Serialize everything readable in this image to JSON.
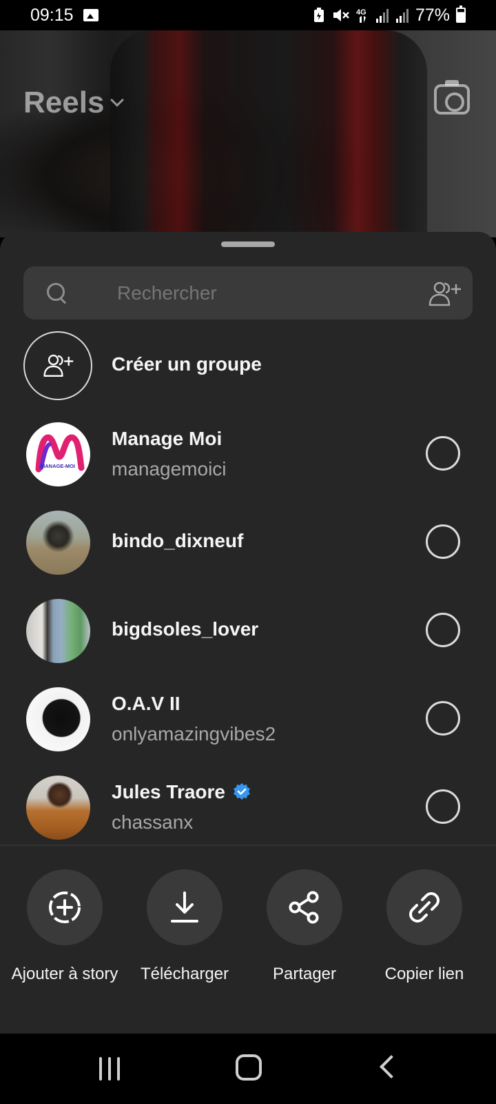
{
  "status_bar": {
    "time": "09:15",
    "battery": "77%",
    "network": "4G",
    "battery_level": 0.77
  },
  "background": {
    "title": "Reels"
  },
  "sheet": {
    "search": {
      "placeholder": "Rechercher"
    },
    "create_group": {
      "label": "Créer un groupe"
    },
    "contacts": [
      {
        "name": "Manage Moi",
        "username": "managemoici",
        "verified": false,
        "avatar_text": "MANAGE-MOI"
      },
      {
        "name": "bindo_dixneuf",
        "username": "",
        "verified": false
      },
      {
        "name": "bigdsoles_lover",
        "username": "",
        "verified": false
      },
      {
        "name": "O.A.V II",
        "username": "onlyamazingvibes2",
        "verified": false
      },
      {
        "name": "Jules Traore",
        "username": "chassanx",
        "verified": true
      }
    ],
    "actions": [
      {
        "label": "Ajouter à story",
        "icon": "add-circle-icon"
      },
      {
        "label": "Télécharger",
        "icon": "download-icon"
      },
      {
        "label": "Partager",
        "icon": "share-icon"
      },
      {
        "label": "Copier lien",
        "icon": "link-icon"
      }
    ]
  },
  "colors": {
    "sheet_bg": "#262626",
    "search_bg": "#3a3a3a",
    "verified_blue": "#3797f0",
    "secondary_text": "#a8a8a8"
  }
}
